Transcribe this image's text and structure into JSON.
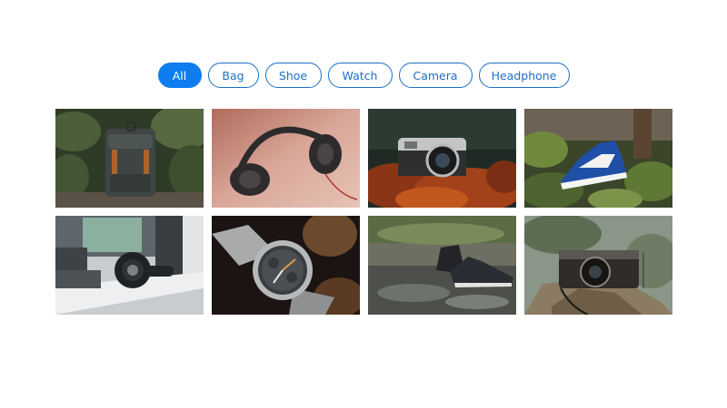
{
  "filters": [
    {
      "label": "All",
      "active": true
    },
    {
      "label": "Bag",
      "active": false
    },
    {
      "label": "Shoe",
      "active": false
    },
    {
      "label": "Watch",
      "active": false
    },
    {
      "label": "Camera",
      "active": false
    },
    {
      "label": "Headphone",
      "active": false
    }
  ],
  "accent_color": "#0d7df0",
  "outline_color": "#1b6fc7",
  "gallery": [
    {
      "icon": "backpack-photo"
    },
    {
      "icon": "headphones-photo"
    },
    {
      "icon": "camera-photo"
    },
    {
      "icon": "sneaker-photo"
    },
    {
      "icon": "headphones-desk-photo"
    },
    {
      "icon": "wristwatch-photo"
    },
    {
      "icon": "sneakers-puddle-photo"
    },
    {
      "icon": "retro-camera-photo"
    }
  ]
}
